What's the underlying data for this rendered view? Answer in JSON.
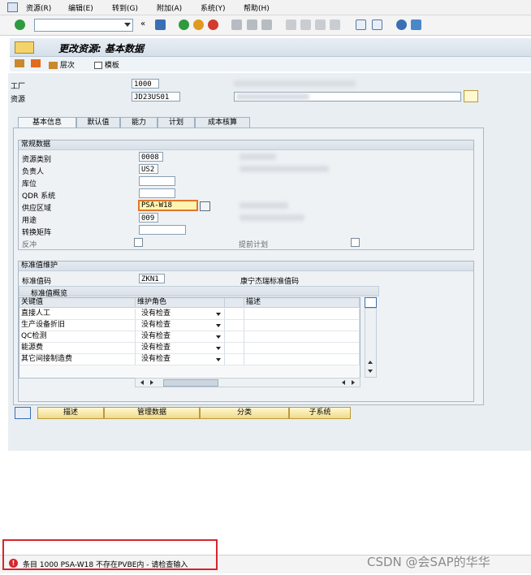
{
  "menu": {
    "items": [
      "资源(R)",
      "编辑(E)",
      "转到(G)",
      "附加(A)",
      "系统(Y)",
      "帮助(H)"
    ]
  },
  "toolbar": {
    "command_value": "",
    "icons": [
      "enter-icon",
      "back-icon",
      "save-icon",
      "back-nav-icon",
      "exit-icon",
      "cancel-icon",
      "print-icon",
      "find-icon",
      "find-next-icon",
      "first-page-icon",
      "prev-page-icon",
      "next-page-icon",
      "last-page-icon",
      "new-session-icon",
      "shortcut-icon",
      "help-icon",
      "layout-icon"
    ]
  },
  "title": "更改资源: 基本数据",
  "subtoolbar": {
    "hierarchy_label": "层次",
    "template_label": "模板"
  },
  "header": {
    "plant_label": "工厂",
    "plant_value": "1000",
    "resource_label": "资源",
    "resource_value": "JD23US01"
  },
  "tabs": [
    "基本信息",
    "默认值",
    "能力",
    "计划",
    "成本核算"
  ],
  "general": {
    "title": "常规数据",
    "fields": [
      {
        "label": "资源类别",
        "value": "0008"
      },
      {
        "label": "负责人",
        "value": "US2"
      },
      {
        "label": "库位",
        "value": ""
      },
      {
        "label": "QDR 系统",
        "value": ""
      },
      {
        "label": "供应区域",
        "value": "PSA-W18"
      },
      {
        "label": "用途",
        "value": "009"
      },
      {
        "label": "转换矩阵",
        "value": ""
      }
    ],
    "backflush_label": "反冲",
    "advance_plan_label": "提前计划"
  },
  "std_values": {
    "title": "标准值维护",
    "key_label": "标准值码",
    "key_value": "ZKN1",
    "key_desc": "康宁杰瑞标准值码",
    "overview_title": "标准值概览",
    "columns": [
      "关键值",
      "维护角色",
      "描述"
    ],
    "rows": [
      {
        "key": "直接人工",
        "role": "没有检查"
      },
      {
        "key": "生产设备折旧",
        "role": "没有检查"
      },
      {
        "key": "QC检测",
        "role": "没有检查"
      },
      {
        "key": "能源费",
        "role": "没有检查"
      },
      {
        "key": "其它间接制造费",
        "role": "没有检查"
      }
    ]
  },
  "buttons": {
    "describe": "描述",
    "manage": "管理数据",
    "classify": "分类",
    "subsystem": "子系统"
  },
  "status": {
    "message": "条目 1000 PSA-W18  不存在PVBE内 - 请检查输入"
  },
  "watermark": "CSDN @会SAP的华华",
  "colors": {
    "error": "#d6262c",
    "highlight_field": "#fff3b0",
    "button": "#f1d98a"
  }
}
